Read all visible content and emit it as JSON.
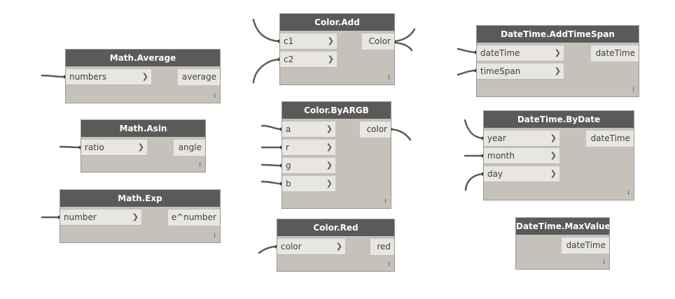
{
  "nodes": {
    "math_average": {
      "title": "Math.Average",
      "inputs": [
        "numbers"
      ],
      "outputs": [
        "average"
      ],
      "lacing": "I"
    },
    "math_asin": {
      "title": "Math.Asin",
      "inputs": [
        "ratio"
      ],
      "outputs": [
        "angle"
      ],
      "lacing": "I"
    },
    "math_exp": {
      "title": "Math.Exp",
      "inputs": [
        "number"
      ],
      "outputs": [
        "e^number"
      ],
      "lacing": "I"
    },
    "color_add": {
      "title": "Color.Add",
      "inputs": [
        "c1",
        "c2"
      ],
      "outputs": [
        "Color"
      ],
      "lacing": "I"
    },
    "color_byargb": {
      "title": "Color.ByARGB",
      "inputs": [
        "a",
        "r",
        "g",
        "b"
      ],
      "outputs": [
        "color"
      ],
      "lacing": "I"
    },
    "color_red": {
      "title": "Color.Red",
      "inputs": [
        "color"
      ],
      "outputs": [
        "red"
      ],
      "lacing": "I"
    },
    "datetime_addtimespan": {
      "title": "DateTime.AddTimeSpan",
      "inputs": [
        "dateTime",
        "timeSpan"
      ],
      "outputs": [
        "dateTime"
      ],
      "lacing": "I"
    },
    "datetime_bydate": {
      "title": "DateTime.ByDate",
      "inputs": [
        "year",
        "month",
        "day"
      ],
      "outputs": [
        "dateTime"
      ],
      "lacing": "I"
    },
    "datetime_maxvalue": {
      "title": "DateTime.MaxValue",
      "inputs": [],
      "outputs": [
        "dateTime"
      ],
      "lacing": "I"
    }
  },
  "icons": {
    "input_arrow": "chevron-right-icon"
  },
  "colors": {
    "node_header": "#5a5a5a",
    "node_body": "#c6c2bb",
    "port_background": "#e8e6e2",
    "wire": "#5b5b5b"
  }
}
